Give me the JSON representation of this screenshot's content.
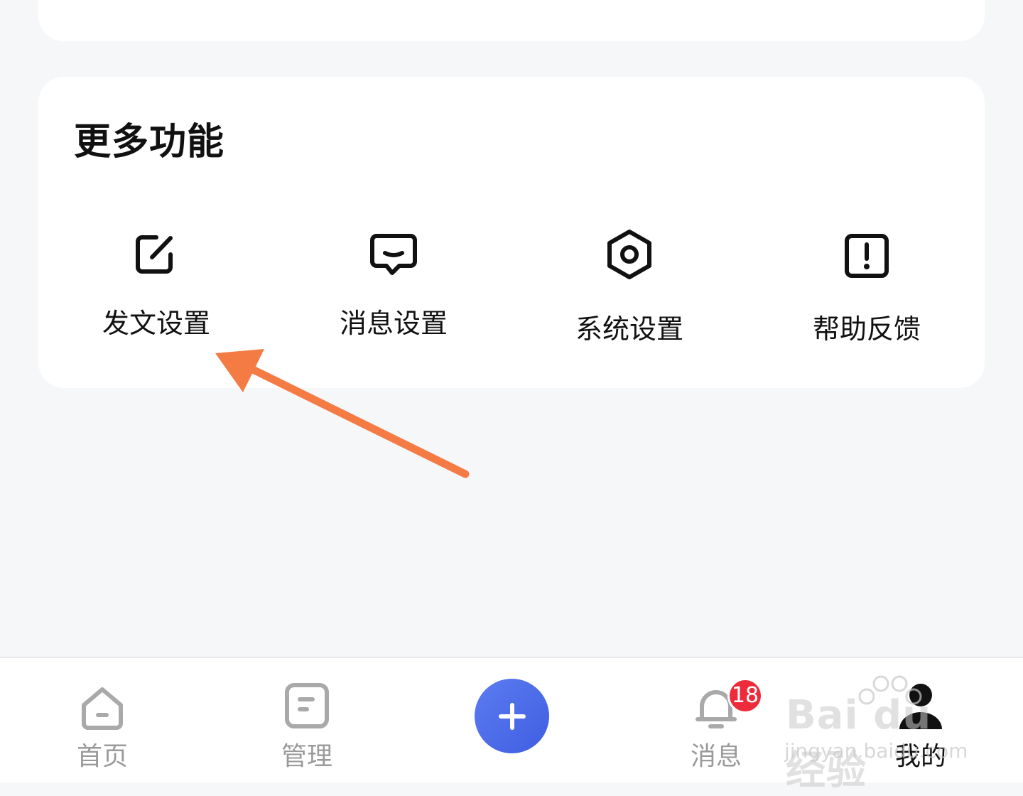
{
  "more_section": {
    "title": "更多功能",
    "items": [
      {
        "label": "发文设置",
        "icon": "edit-square-icon"
      },
      {
        "label": "消息设置",
        "icon": "message-bubble-icon"
      },
      {
        "label": "系统设置",
        "icon": "hexagon-gear-icon"
      },
      {
        "label": "帮助反馈",
        "icon": "exclamation-square-icon"
      }
    ]
  },
  "annotation": {
    "arrow_color": "#f57b45"
  },
  "tabbar": {
    "home_label": "首页",
    "manage_label": "管理",
    "messages_label": "消息",
    "messages_badge": "18",
    "me_label": "我的",
    "fab_color": "#4a68e8",
    "badge_color": "#ee2b3b"
  },
  "watermark": {
    "brand": "Bai du 经验",
    "url": "jingyan.baidu.com"
  }
}
